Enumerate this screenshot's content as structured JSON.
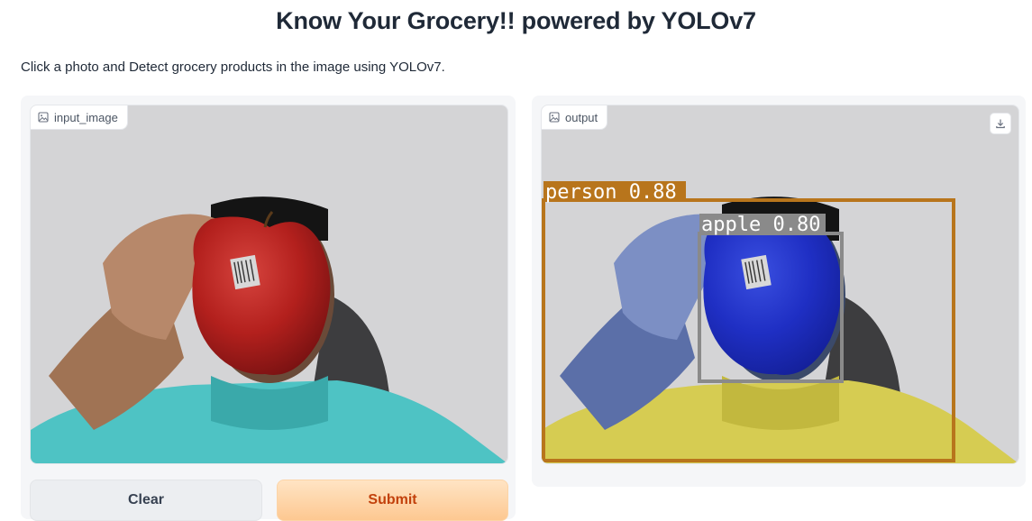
{
  "page": {
    "title": "Know Your Grocery!! powered by YOLOv7",
    "description": "Click a photo and Detect grocery products in the image using YOLOv7."
  },
  "input_panel": {
    "label": "input_image",
    "icon": "image-icon"
  },
  "output_panel": {
    "label": "output",
    "icon": "image-icon",
    "download_icon": "download-icon",
    "detections": [
      {
        "label": "person 0.88",
        "color": "#b8751c"
      },
      {
        "label": "apple 0.80",
        "color": "#8a8a8a"
      }
    ]
  },
  "buttons": {
    "clear_label": "Clear",
    "submit_label": "Submit"
  },
  "colors": {
    "accent": "#f97316",
    "submit_bg": "#fdc891"
  }
}
